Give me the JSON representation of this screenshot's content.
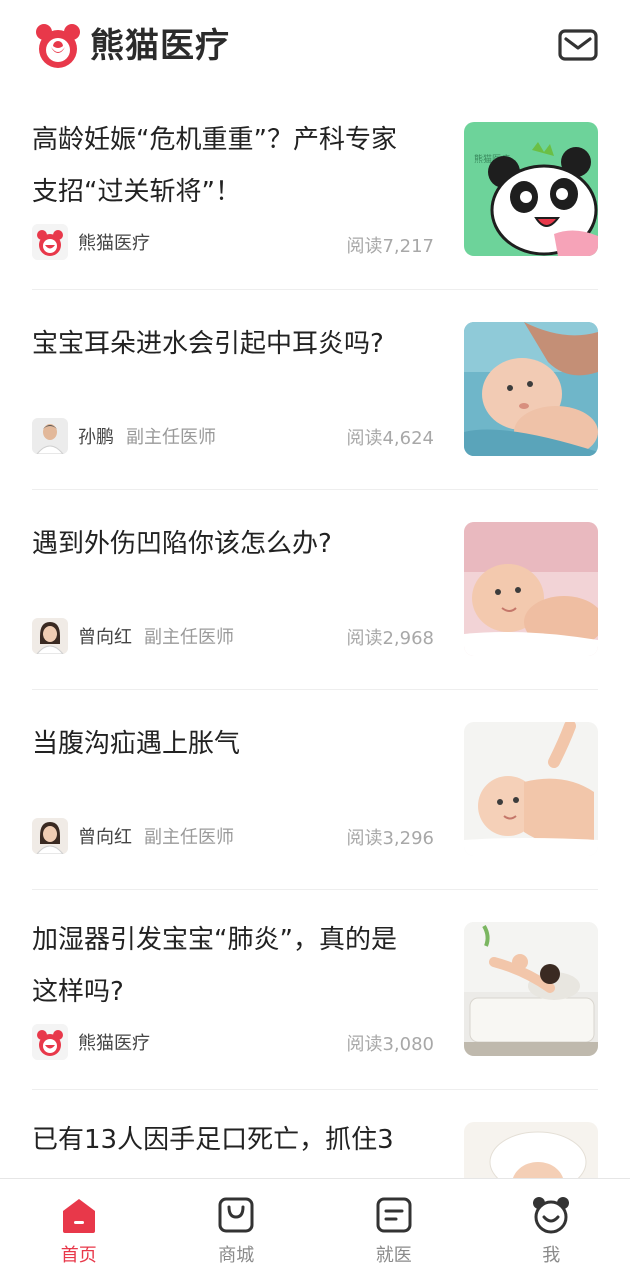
{
  "app": {
    "name": "熊猫医疗",
    "brand_color": "#e8384a"
  },
  "header": {
    "logo_icon": "panda-logo-icon",
    "mail_icon": "mail-icon"
  },
  "articles": [
    {
      "title": "高龄妊娠“危机重重”？产科专家支招“过关斩将”！",
      "author": "熊猫医疗",
      "role": "",
      "reads": "阅读7,217",
      "avatar": "panda-logo",
      "thumb": "panda-cartoon"
    },
    {
      "title": "宝宝耳朵进水会引起中耳炎吗?",
      "author": "孙鹏",
      "role": "副主任医师",
      "reads": "阅读4,624",
      "avatar": "doctor-photo",
      "thumb": "baby-bath"
    },
    {
      "title": "遇到外伤凹陷你该怎么办?",
      "author": "曾向红",
      "role": "副主任医师",
      "reads": "阅读2,968",
      "avatar": "doctor-photo",
      "thumb": "baby-lying"
    },
    {
      "title": "当腹沟疝遇上胀气",
      "author": "曾向红",
      "role": "副主任医师",
      "reads": "阅读3,296",
      "avatar": "doctor-photo",
      "thumb": "baby-massage"
    },
    {
      "title": "加湿器引发宝宝“肺炎”，真的是这样吗?",
      "author": "熊猫医疗",
      "role": "",
      "reads": "阅读3,080",
      "avatar": "panda-logo",
      "thumb": "mother-baby-bed"
    },
    {
      "title": "已有13人因手足口死亡，抓住3",
      "author": "",
      "role": "",
      "reads": "",
      "avatar": "",
      "thumb": "baby-towel"
    }
  ],
  "tabs": [
    {
      "label": "首页",
      "icon": "home-icon",
      "active": true
    },
    {
      "label": "商城",
      "icon": "shop-bag-icon",
      "active": false
    },
    {
      "label": "就医",
      "icon": "clinic-card-icon",
      "active": false
    },
    {
      "label": "我",
      "icon": "panda-face-icon",
      "active": false
    }
  ]
}
